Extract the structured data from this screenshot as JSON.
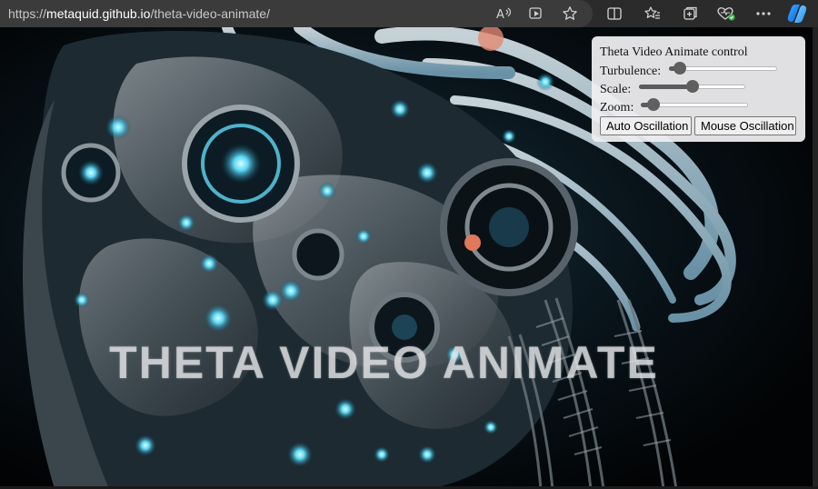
{
  "browser": {
    "url_prefix": "https://",
    "url_host": "metaquid.github.io",
    "url_path": "/theta-video-animate/",
    "url_icons": [
      "read-aloud-icon",
      "immersive-reader-icon",
      "favorite-star-icon"
    ],
    "toolbar_icons": [
      "split-screen-icon",
      "favorites-icon",
      "collections-icon",
      "browser-essentials-icon",
      "more-options-icon",
      "copilot-icon"
    ]
  },
  "page": {
    "overlay_title": "THETA VIDEO ANIMATE"
  },
  "control_panel": {
    "title": "Theta Video Animate control",
    "turbulence_label": "Turbulence:",
    "turbulence_value": 0.05,
    "scale_label": "Scale:",
    "scale_value": 0.5,
    "zoom_label": "Zoom:",
    "zoom_value": 0.07,
    "auto_button_label": "Auto Oscillation",
    "mouse_button_label": "Mouse Oscillation"
  },
  "colors": {
    "accent_cyan": "#5fd8f5",
    "panel_bg": "#eeeef0",
    "chrome_bg": "#2b2b2b"
  }
}
